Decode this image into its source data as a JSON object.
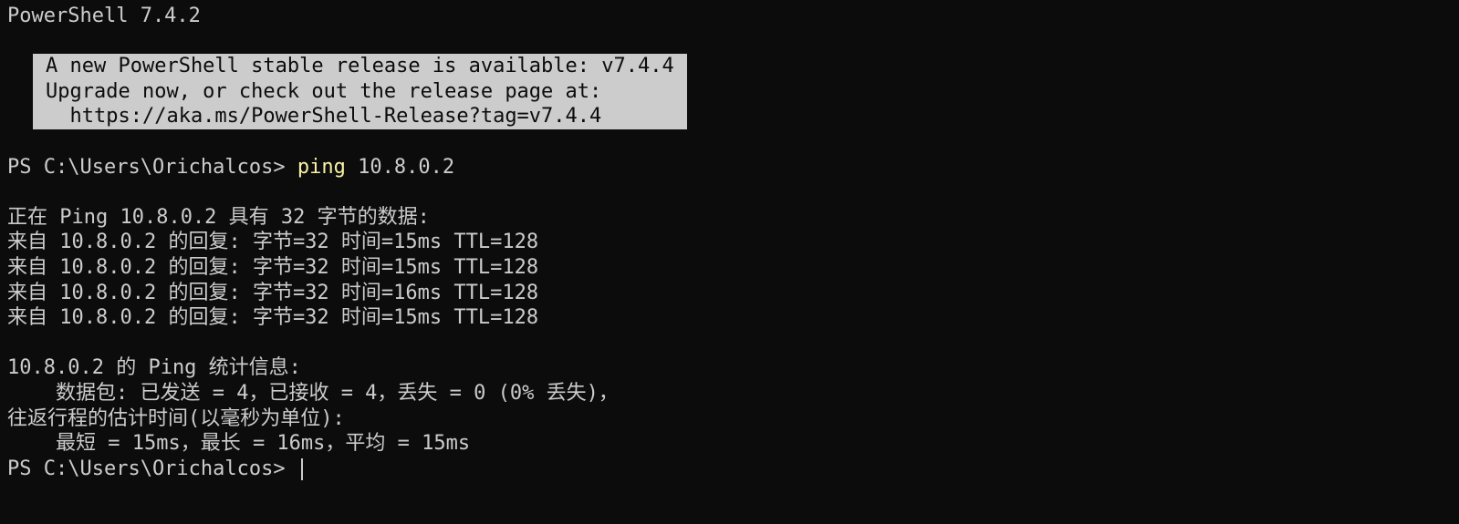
{
  "terminal": {
    "banner": "PowerShell 7.4.2",
    "notice": {
      "line1": "A new PowerShell stable release is available: v7.4.4",
      "line2": "Upgrade now, or check out the release page at:",
      "line3": "  https://aka.ms/PowerShell-Release?tag=v7.4.4"
    },
    "prompt": "PS C:\\Users\\Orichalcos> ",
    "command_name": "ping",
    "command_args": " 10.8.0.2",
    "ping_header": "正在 Ping 10.8.0.2 具有 32 字节的数据:",
    "replies": [
      "来自 10.8.0.2 的回复: 字节=32 时间=15ms TTL=128",
      "来自 10.8.0.2 的回复: 字节=32 时间=15ms TTL=128",
      "来自 10.8.0.2 的回复: 字节=32 时间=16ms TTL=128",
      "来自 10.8.0.2 的回复: 字节=32 时间=15ms TTL=128"
    ],
    "stats_header": "10.8.0.2 的 Ping 统计信息:",
    "stats_packets": "    数据包: 已发送 = 4，已接收 = 4，丢失 = 0 (0% 丢失)，",
    "rtt_header": "往返行程的估计时间(以毫秒为单位):",
    "rtt_values": "    最短 = 15ms，最长 = 16ms，平均 = 15ms",
    "final_prompt": "PS C:\\Users\\Orichalcos> "
  },
  "colors": {
    "background": "#0c0c0c",
    "foreground": "#cccccc",
    "command": "#f9f1a5",
    "notice_background": "#cccccc",
    "notice_text": "#0c0c0c"
  }
}
